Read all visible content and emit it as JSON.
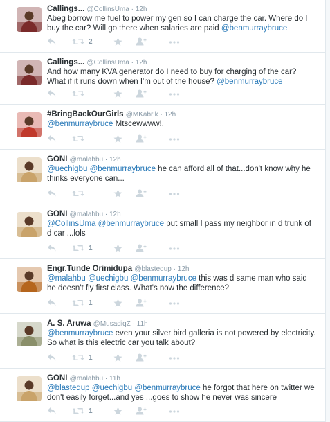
{
  "tweets": [
    {
      "fullname": "Callings...",
      "handle": "@CollinsUma",
      "time": "12h",
      "text": [
        {
          "t": "Abeg borrow me fuel to power my gen so I can charge the car. Where do I buy the car? Will go there when salaries are paid ",
          "m": false
        },
        {
          "t": "@benmurraybruce",
          "m": true
        }
      ],
      "retweets": "2",
      "avatar_color": "#7a2a2a"
    },
    {
      "fullname": "Callings...",
      "handle": "@CollinsUma",
      "time": "12h",
      "text": [
        {
          "t": "And how many KVA generator do I need to buy for charging of the car? What if it runs down when I'm out of the house? ",
          "m": false
        },
        {
          "t": "@benmurraybruce",
          "m": true
        }
      ],
      "retweets": "",
      "avatar_color": "#7a2a2a"
    },
    {
      "fullname": "#BringBackOurGirls",
      "handle": "@MKabrik",
      "time": "12h",
      "text": [
        {
          "t": "@benmurraybruce",
          "m": true
        },
        {
          "t": " Mtscewwww!.",
          "m": false
        }
      ],
      "retweets": "",
      "avatar_color": "#c0392b"
    },
    {
      "fullname": "GONI",
      "handle": "@malahbu",
      "time": "12h",
      "text": [
        {
          "t": "@uechigbu",
          "m": true
        },
        {
          "t": " ",
          "m": false
        },
        {
          "t": "@benmurraybruce",
          "m": true
        },
        {
          "t": " he can afford all of that...don't know why he thinks everyone can...",
          "m": false
        }
      ],
      "retweets": "",
      "avatar_color": "#c9a36a"
    },
    {
      "fullname": "GONI",
      "handle": "@malahbu",
      "time": "12h",
      "text": [
        {
          "t": "@CollinsUma",
          "m": true
        },
        {
          "t": " ",
          "m": false
        },
        {
          "t": "@benmurraybruce",
          "m": true
        },
        {
          "t": " put small I pass my neighbor in d trunk of d car ...lols",
          "m": false
        }
      ],
      "retweets": "1",
      "avatar_color": "#c9a36a"
    },
    {
      "fullname": "Engr.Tunde Orimidupa",
      "handle": "@blastedup",
      "time": "12h",
      "text": [
        {
          "t": "@malahbu",
          "m": true
        },
        {
          "t": " ",
          "m": false
        },
        {
          "t": "@uechigbu",
          "m": true
        },
        {
          "t": " ",
          "m": false
        },
        {
          "t": "@benmurraybruce",
          "m": true
        },
        {
          "t": " this was d same man who said he doesn't fly first class. What's now the difference?",
          "m": false
        }
      ],
      "retweets": "1",
      "avatar_color": "#b5651d"
    },
    {
      "fullname": "A. S. Aruwa",
      "handle": "@MusadiqZ",
      "time": "11h",
      "text": [
        {
          "t": "@benmurraybruce",
          "m": true
        },
        {
          "t": " even your silver bird galleria is not powered by electricity. So what is this electric car you talk about?",
          "m": false
        }
      ],
      "retweets": "1",
      "avatar_color": "#8a8f6a"
    },
    {
      "fullname": "GONI",
      "handle": "@malahbu",
      "time": "11h",
      "text": [
        {
          "t": "@blastedup",
          "m": true
        },
        {
          "t": " ",
          "m": false
        },
        {
          "t": "@uechigbu",
          "m": true
        },
        {
          "t": " ",
          "m": false
        },
        {
          "t": "@benmurraybruce",
          "m": true
        },
        {
          "t": " he forgot that here on twitter we don't easily forget...and yes ...goes to show he never was sincere",
          "m": false
        }
      ],
      "retweets": "1",
      "avatar_color": "#c9a36a"
    }
  ],
  "colors": {
    "link": "#2b7bb9",
    "muted": "#8899a6",
    "text": "#292f33",
    "border": "#e1e8ed"
  },
  "icons": [
    "reply-icon",
    "retweet-icon",
    "favorite-icon",
    "follow-icon",
    "more-icon"
  ]
}
